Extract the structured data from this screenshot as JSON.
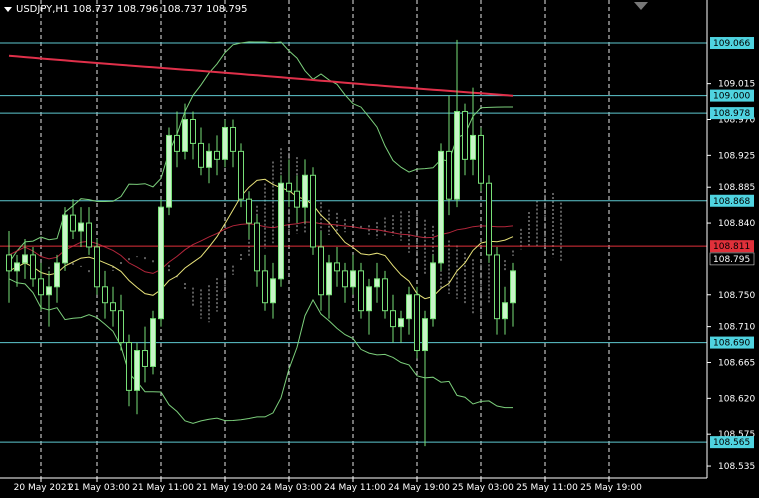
{
  "header": {
    "symbol": "USDJPY,H1",
    "ohlc": "108.737 108.796 108.737 108.795"
  },
  "colors": {
    "background": "#000000",
    "axis": "#ffffff",
    "grid": "#ffffff",
    "candle_up": "#c8f5c8",
    "candle_down": "#000000",
    "candle_outline": "#78e078",
    "ma_slow": "#e0304a",
    "ma_fast": "#e8e27a",
    "bollinger": "#7ccf7c",
    "ichimoku_cloud": "#e8e8e8",
    "support_line": "#5ec8d0",
    "red_line": "#e0303a",
    "label_cyan": "#4fd3e0",
    "label_red": "#e0303a"
  },
  "chart_data": {
    "type": "candlestick",
    "symbol": "USDJPY,H1",
    "ylim": [
      108.52,
      109.12
    ],
    "y_ticks": [
      109.015,
      108.97,
      108.925,
      108.885,
      108.84,
      108.75,
      108.71,
      108.665,
      108.62,
      108.575,
      108.535
    ],
    "x_ticks": [
      {
        "label": "20 May 2021",
        "idx": 4
      },
      {
        "label": "21 May 03:00",
        "idx": 11
      },
      {
        "label": "21 May 11:00",
        "idx": 19
      },
      {
        "label": "21 May 19:00",
        "idx": 27
      },
      {
        "label": "24 May 03:00",
        "idx": 35
      },
      {
        "label": "24 May 11:00",
        "idx": 43
      },
      {
        "label": "24 May 19:00",
        "idx": 51
      },
      {
        "label": "25 May 03:00",
        "idx": 59
      },
      {
        "label": "25 May 11:00",
        "idx": 67
      },
      {
        "label": "25 May 19:00",
        "idx": 75
      }
    ],
    "current_price": 108.795,
    "horizontal_levels": [
      {
        "value": 109.066,
        "label": "109.066",
        "kind": "cyan"
      },
      {
        "value": 109.0,
        "label": "109.000",
        "kind": "cyan"
      },
      {
        "value": 108.978,
        "label": "108.978",
        "kind": "cyan"
      },
      {
        "value": 108.868,
        "label": "108.868",
        "kind": "cyan"
      },
      {
        "value": 108.811,
        "label": "108.811",
        "kind": "red"
      },
      {
        "value": 108.69,
        "label": "108.690",
        "kind": "cyan"
      },
      {
        "value": 108.565,
        "label": "108.565",
        "kind": "cyan"
      }
    ],
    "candles": [
      [
        108.8,
        108.83,
        108.74,
        108.78
      ],
      [
        108.78,
        108.8,
        108.76,
        108.79
      ],
      [
        108.79,
        108.82,
        108.77,
        108.8
      ],
      [
        108.8,
        108.81,
        108.76,
        108.77
      ],
      [
        108.77,
        108.79,
        108.73,
        108.75
      ],
      [
        108.75,
        108.78,
        108.71,
        108.76
      ],
      [
        108.76,
        108.8,
        108.74,
        108.79
      ],
      [
        108.79,
        108.86,
        108.78,
        108.85
      ],
      [
        108.85,
        108.87,
        108.82,
        108.83
      ],
      [
        108.83,
        108.86,
        108.81,
        108.84
      ],
      [
        108.84,
        108.86,
        108.8,
        108.81
      ],
      [
        108.81,
        108.82,
        108.75,
        108.76
      ],
      [
        108.76,
        108.78,
        108.72,
        108.74
      ],
      [
        108.74,
        108.76,
        108.71,
        108.73
      ],
      [
        108.73,
        108.75,
        108.68,
        108.69
      ],
      [
        108.69,
        108.7,
        108.61,
        108.63
      ],
      [
        108.63,
        108.69,
        108.6,
        108.68
      ],
      [
        108.68,
        108.71,
        108.64,
        108.66
      ],
      [
        108.66,
        108.73,
        108.65,
        108.72
      ],
      [
        108.72,
        108.87,
        108.71,
        108.86
      ],
      [
        108.86,
        108.96,
        108.85,
        108.95
      ],
      [
        108.95,
        108.98,
        108.91,
        108.93
      ],
      [
        108.93,
        108.99,
        108.92,
        108.97
      ],
      [
        108.97,
        108.98,
        108.92,
        108.94
      ],
      [
        108.94,
        108.96,
        108.9,
        108.91
      ],
      [
        108.91,
        108.94,
        108.89,
        108.93
      ],
      [
        108.93,
        108.95,
        108.9,
        108.92
      ],
      [
        108.92,
        108.97,
        108.91,
        108.96
      ],
      [
        108.96,
        108.97,
        108.91,
        108.93
      ],
      [
        108.93,
        108.94,
        108.86,
        108.87
      ],
      [
        108.87,
        108.88,
        108.82,
        108.84
      ],
      [
        108.84,
        108.85,
        108.76,
        108.78
      ],
      [
        108.78,
        108.8,
        108.73,
        108.74
      ],
      [
        108.74,
        108.79,
        108.72,
        108.77
      ],
      [
        108.77,
        108.9,
        108.76,
        108.89
      ],
      [
        108.89,
        108.92,
        108.86,
        108.88
      ],
      [
        108.88,
        108.9,
        108.84,
        108.86
      ],
      [
        108.86,
        108.92,
        108.84,
        108.9
      ],
      [
        108.9,
        108.91,
        108.8,
        108.81
      ],
      [
        108.81,
        108.83,
        108.73,
        108.75
      ],
      [
        108.75,
        108.8,
        108.72,
        108.79
      ],
      [
        108.79,
        108.81,
        108.76,
        108.78
      ],
      [
        108.78,
        108.79,
        108.74,
        108.76
      ],
      [
        108.76,
        108.8,
        108.75,
        108.78
      ],
      [
        108.78,
        108.79,
        108.72,
        108.73
      ],
      [
        108.73,
        108.77,
        108.7,
        108.76
      ],
      [
        108.76,
        108.79,
        108.74,
        108.77
      ],
      [
        108.77,
        108.78,
        108.72,
        108.73
      ],
      [
        108.73,
        108.75,
        108.69,
        108.71
      ],
      [
        108.71,
        108.73,
        108.69,
        108.72
      ],
      [
        108.72,
        108.76,
        108.7,
        108.75
      ],
      [
        108.75,
        108.76,
        108.67,
        108.68
      ],
      [
        108.68,
        108.73,
        108.56,
        108.72
      ],
      [
        108.72,
        108.8,
        108.71,
        108.79
      ],
      [
        108.79,
        108.94,
        108.78,
        108.93
      ],
      [
        108.93,
        109.0,
        108.85,
        108.87
      ],
      [
        108.87,
        109.07,
        108.86,
        108.98
      ],
      [
        108.98,
        108.99,
        108.9,
        108.92
      ],
      [
        108.92,
        109.01,
        108.9,
        108.95
      ],
      [
        108.95,
        108.96,
        108.88,
        108.89
      ],
      [
        108.89,
        108.9,
        108.79,
        108.8
      ],
      [
        108.8,
        108.81,
        108.7,
        108.72
      ],
      [
        108.72,
        108.76,
        108.7,
        108.74
      ],
      [
        108.74,
        108.79,
        108.71,
        108.78
      ]
    ]
  }
}
